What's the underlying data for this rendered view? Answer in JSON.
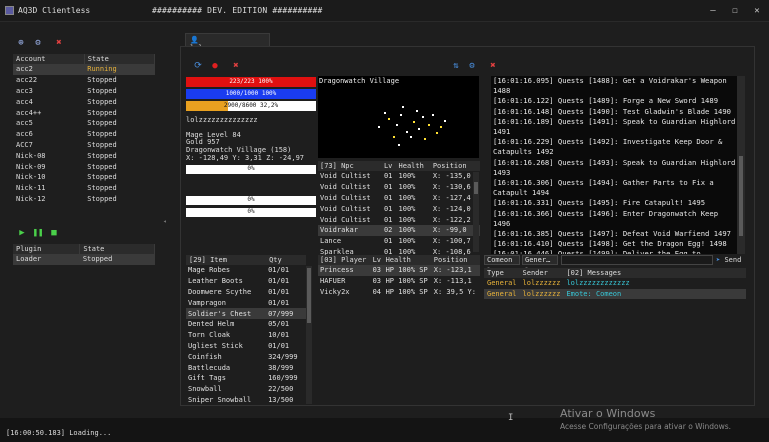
{
  "window": {
    "title": "AQ3D Clientless",
    "edition": "########## DEV. EDITION ##########",
    "controls": [
      "—",
      "☐",
      "✕"
    ]
  },
  "accounts": {
    "headers": [
      "Account",
      "State"
    ],
    "rows": [
      {
        "name": "acc2",
        "state": "Running"
      },
      {
        "name": "acc22",
        "state": "Stopped"
      },
      {
        "name": "acc3",
        "state": "Stopped"
      },
      {
        "name": "acc4",
        "state": "Stopped"
      },
      {
        "name": "acc4++",
        "state": "Stopped"
      },
      {
        "name": "acc5",
        "state": "Stopped"
      },
      {
        "name": "acc6",
        "state": "Stopped"
      },
      {
        "name": "ACC7",
        "state": "Stopped"
      },
      {
        "name": "Nick-08",
        "state": "Stopped"
      },
      {
        "name": "Nick-09",
        "state": "Stopped"
      },
      {
        "name": "Nick-10",
        "state": "Stopped"
      },
      {
        "name": "Nick-11",
        "state": "Stopped"
      },
      {
        "name": "Nick-12",
        "state": "Stopped"
      }
    ]
  },
  "plugins": {
    "headers": [
      "Plugin",
      "State"
    ],
    "rows": [
      {
        "name": "Loader",
        "state": "Stopped"
      }
    ]
  },
  "tab": {
    "label": "lolzzzzzzzzzzzzzz"
  },
  "bars": {
    "hp": {
      "text": "223/223 100%",
      "value": 1.0,
      "color": "#e01010"
    },
    "mp": {
      "text": "1000/1000 100%",
      "value": 1.0,
      "color": "#1a3cf0"
    },
    "xp": {
      "text": "2900/8600 32,2%",
      "value": 0.322,
      "color": "#e8a020"
    }
  },
  "char": {
    "name": "lolzzzzzzzzzzzzzz",
    "level": "Mage Level 84",
    "gold": "Gold 957",
    "map": "Dragonwatch Village (158)",
    "coords": "X: -128,49 Y: 3,31 Z: -24,97",
    "box1": "0%",
    "box2": "0%",
    "box3": "0%"
  },
  "map": {
    "title": "Dragonwatch Village"
  },
  "npcs": {
    "headers": [
      "[73] Npc",
      "Lv",
      "Health",
      "Position"
    ],
    "rows": [
      {
        "name": "Void Cultist",
        "lv": "01",
        "hp": "100%",
        "pos": "X:  -135,0"
      },
      {
        "name": "Void Cultist",
        "lv": "01",
        "hp": "100%",
        "pos": "X:  -130,6"
      },
      {
        "name": "Void Cultist",
        "lv": "01",
        "hp": "100%",
        "pos": "X:  -127,4"
      },
      {
        "name": "Void Cultist",
        "lv": "01",
        "hp": "100%",
        "pos": "X:  -124,0"
      },
      {
        "name": "Void Cultist",
        "lv": "01",
        "hp": "100%",
        "pos": "X:  -122,2"
      },
      {
        "name": "Voidrakar",
        "lv": "02",
        "hp": "100%",
        "pos": "X:  -99,0"
      },
      {
        "name": "Lance",
        "lv": "01",
        "hp": "100%",
        "pos": "X:  -100,7"
      },
      {
        "name": "Sparklea",
        "lv": "01",
        "hp": "100%",
        "pos": "X:  -108,6"
      }
    ]
  },
  "log": [
    "[16:01:16.095] Quests [1488]: Get a Voidrakar's Weapon",
    "1488",
    "[16:01:16.122] Quests [1489]: Forge a New Sword 1489",
    "[16:01:16.148] Quests [1490]: Test Gladwin's Blade 1490",
    "[16:01:16.189] Quests [1491]: Speak to Guardian Highlord",
    "1491",
    "[16:01:16.229] Quests [1492]: Investigate Keep Door &",
    "Catapults 1492",
    "[16:01:16.268] Quests [1493]: Speak to Guardian Highlord",
    "1493",
    "[16:01:16.306] Quests [1494]: Gather Parts to Fix a",
    "Catapult 1494",
    "[16:01:16.331] Quests [1495]: Fire Catapult! 1495",
    "[16:01:16.366] Quests [1496]: Enter Dragonwatch Keep 1496",
    "[16:01:16.385] Quests [1497]: Defeat Void Warfiend 1497",
    "[16:01:16.410] Quests [1498]: Get the Dragon Egg! 1498",
    "[16:01:16.446] Quests [1499]: Deliver the Egg to Battleon",
    "1499",
    "[16:01:16.478] Quests [2338]: Enter Town 2338"
  ],
  "items": {
    "headers": [
      "[29] Item",
      "Qty"
    ],
    "rows": [
      {
        "name": "Mage Robes",
        "qty": "01/01"
      },
      {
        "name": "Leather Boots",
        "qty": "01/01"
      },
      {
        "name": "Doomwere Scythe",
        "qty": "01/01"
      },
      {
        "name": "Vampragon",
        "qty": "01/01"
      },
      {
        "name": "Soldier's Chest",
        "qty": "07/999"
      },
      {
        "name": "Dented Helm",
        "qty": "05/01"
      },
      {
        "name": "Torn Cloak",
        "qty": "10/01"
      },
      {
        "name": "Ugliest Stick",
        "qty": "01/01"
      },
      {
        "name": "Coinfish",
        "qty": "324/999"
      },
      {
        "name": "Battlecuda",
        "qty": "38/999"
      },
      {
        "name": "Gift Tags",
        "qty": "160/999"
      },
      {
        "name": "Snowball",
        "qty": "22/500"
      },
      {
        "name": "Sniper Snowball",
        "qty": "13/500"
      }
    ]
  },
  "players": {
    "headers": [
      "[03] Player",
      "Lv",
      "Health",
      "Position"
    ],
    "rows": [
      {
        "name": "Princess",
        "lv": "03",
        "hp": "HP 100% SP",
        "pos": "X:  -123,1"
      },
      {
        "name": "HAFUER",
        "lv": "03",
        "hp": "HP 100% SP",
        "pos": "X:  -113,1"
      },
      {
        "name": "Vicky2x",
        "lv": "04",
        "hp": "HP 100% SP",
        "pos": "X:  39,5 Y:"
      }
    ]
  },
  "chat": {
    "channel": "Comeon",
    "type_select": "Gener…",
    "send_label": "Send",
    "headers": [
      "Type",
      "Sender",
      "[02] Messages"
    ],
    "rows": [
      {
        "type": "General",
        "sender": "lolzzzzzz",
        "msg": "lolzzzzzzzzzzzz"
      },
      {
        "type": "General",
        "sender": "lolzzzzzz",
        "msg": "Emote: Comeon"
      }
    ]
  },
  "status": {
    "log_line": "[16:00:50.183] Loading..."
  },
  "watermark": {
    "line1": "Ativar o Windows",
    "line2": "Acesse Configurações para ativar o Windows."
  },
  "colors": {
    "running": "#e8b33a",
    "chat_type": "#e8b33a",
    "chat_msg": "#38c8d8"
  }
}
